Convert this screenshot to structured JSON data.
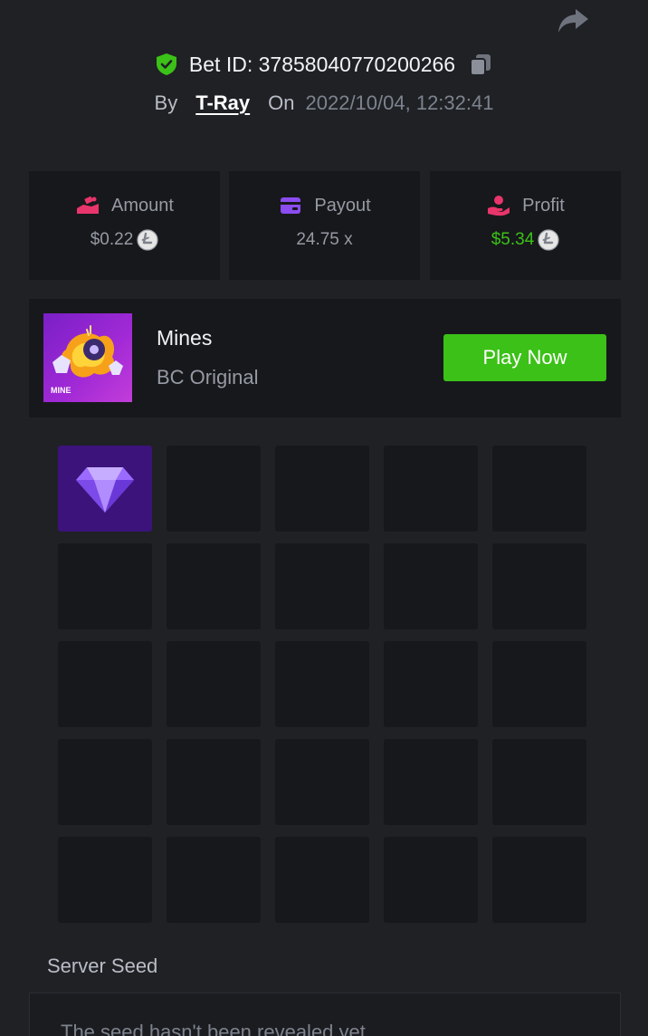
{
  "header": {
    "bet_id_label": "Bet ID: 37858040770200266",
    "by_label": "By",
    "username": "T-Ray",
    "on_label": "On",
    "datetime": "2022/10/04, 12:32:41"
  },
  "stats": {
    "amount": {
      "label": "Amount",
      "value": "$0.22",
      "icon": "hand-coins-icon",
      "coin": "litecoin-icon"
    },
    "payout": {
      "label": "Payout",
      "value": "24.75 x",
      "icon": "card-icon"
    },
    "profit": {
      "label": "Profit",
      "value": "$5.34",
      "icon": "hand-heart-icon",
      "coin": "litecoin-icon"
    }
  },
  "game": {
    "name": "Mines",
    "subtitle": "BC Original",
    "thumb_label": "MINE",
    "play_label": "Play Now"
  },
  "board": {
    "rows": 5,
    "cols": 5,
    "revealed": [
      {
        "row": 0,
        "col": 0,
        "content": "gem"
      }
    ]
  },
  "seed": {
    "section_label": "Server Seed",
    "text": "The seed hasn't been revealed yet"
  },
  "colors": {
    "background": "#1f2125",
    "panel": "#17181b",
    "profit_green": "#3bc117",
    "play_button": "#3bc117",
    "gem_tile": "#3c137a",
    "shield_green": "#3bc117"
  }
}
